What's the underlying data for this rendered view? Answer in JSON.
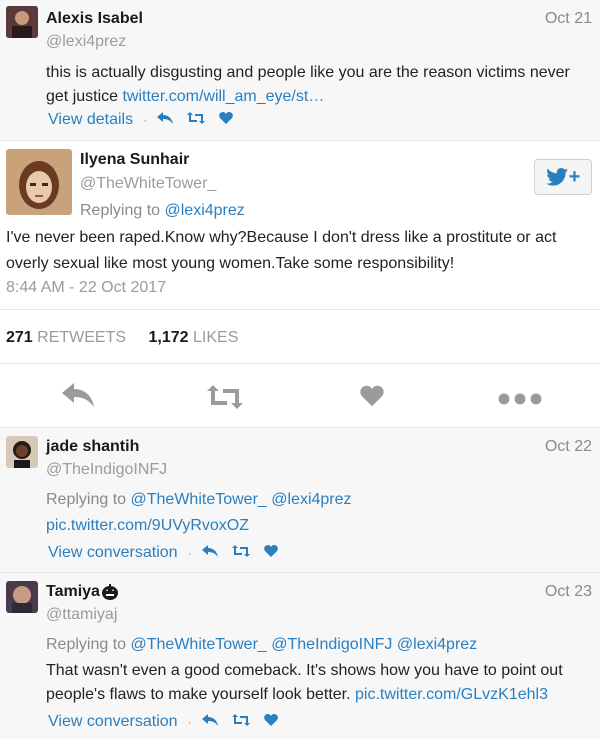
{
  "tweets": [
    {
      "name": "Alexis Isabel",
      "handle": "@lexi4prez",
      "date": "Oct 21",
      "body_text": "this is actually disgusting and people like you are the reason victims never get justice ",
      "body_link": "twitter.com/will_am_eye/st…",
      "action_label": "View details",
      "avatar_color": "#3a2a2a"
    }
  ],
  "main": {
    "name": "Ilyena Sunhair",
    "handle": "@TheWhiteTower_",
    "replying_prefix": "Replying to",
    "replying_to": "@lexi4prez",
    "body": "I've never been raped.Know why?Because  I don't dress like a prostitute or act overly sexual like most young women.Take some responsibility!",
    "timestamp": "8:44 AM - 22 Oct 2017",
    "retweets_count": "271",
    "retweets_label": "RETWEETS",
    "likes_count": "1,172",
    "likes_label": "LIKES",
    "follow_glyph": "+"
  },
  "replies": [
    {
      "name": "jade shantih",
      "handle": "@TheIndigoINFJ",
      "date": "Oct 22",
      "replying_prefix": "Replying to",
      "replying_a": "@TheWhiteTower_",
      "replying_b": "@lexi4prez",
      "body_link": "pic.twitter.com/9UVyRvoxOZ",
      "action_label": "View conversation"
    },
    {
      "name": "Tamiya",
      "handle": "@ttamiyaj",
      "date": "Oct 23",
      "replying_prefix": "Replying to",
      "replying_a": "@TheWhiteTower_",
      "replying_b": "@TheIndigoINFJ",
      "replying_c": "@lexi4prez",
      "body_text": "That wasn't even a good comeback. It's shows how you have to point out people's flaws to make yourself look better. ",
      "body_link": "pic.twitter.com/GLvzK1ehl3",
      "action_label": "View conversation"
    }
  ],
  "colors": {
    "link": "#2a7fc0",
    "muted": "#9b9b9b",
    "reply_bg": "#f7f7f7"
  }
}
